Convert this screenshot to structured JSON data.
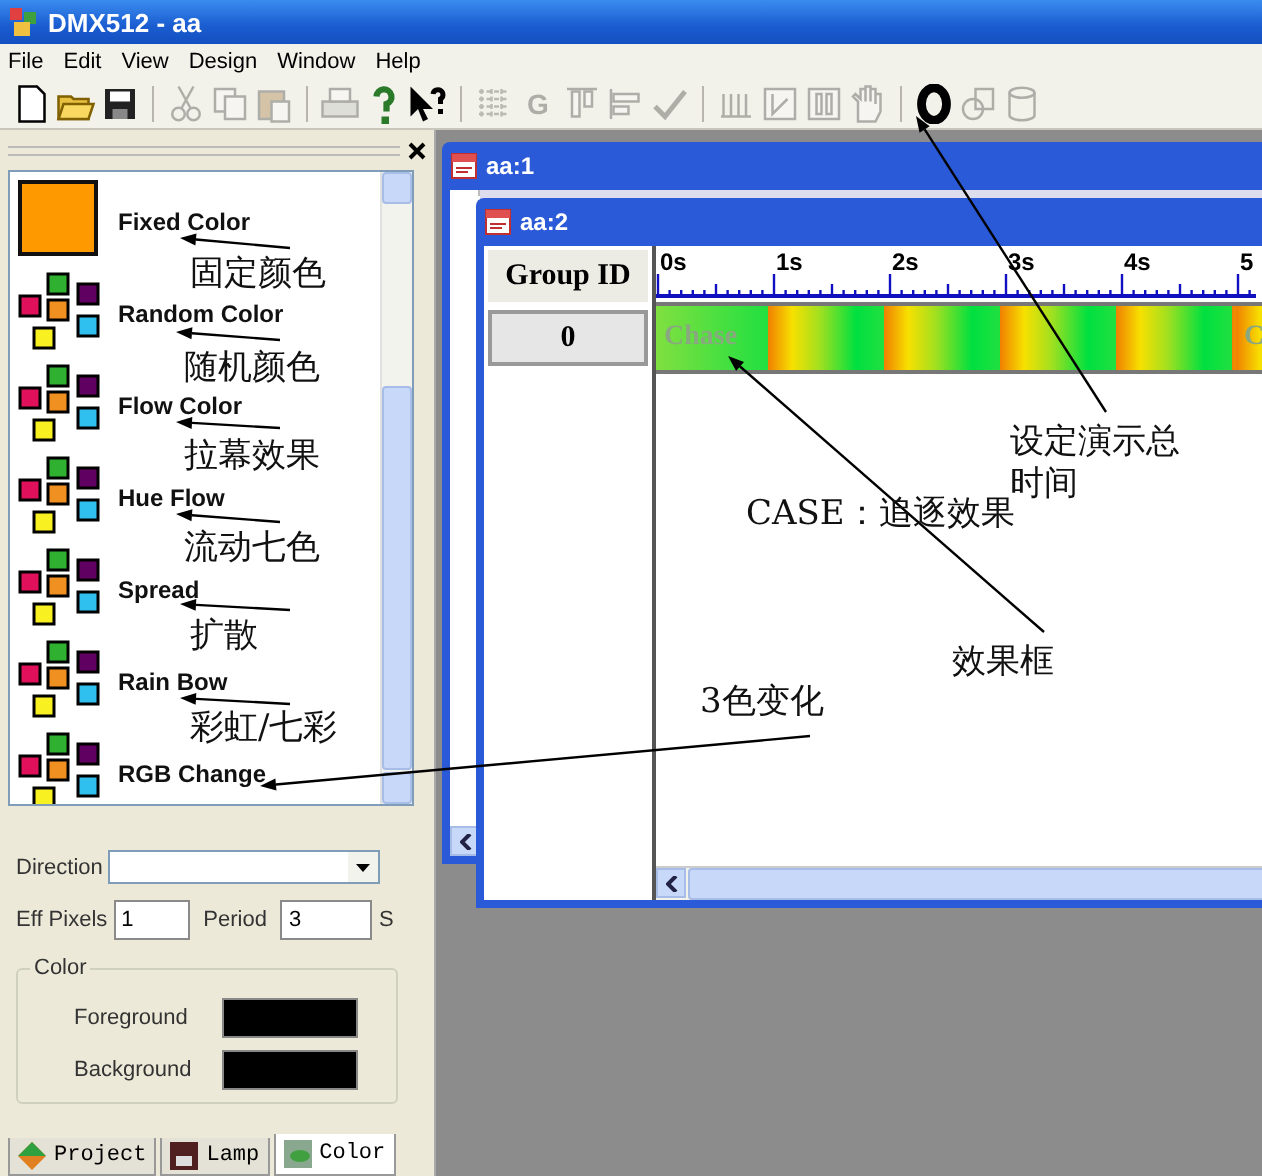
{
  "window": {
    "title": "DMX512 - aa"
  },
  "menu": [
    "File",
    "Edit",
    "View",
    "Design",
    "Window",
    "Help"
  ],
  "toolbar": [
    {
      "kind": "new",
      "disabled": false
    },
    {
      "kind": "open",
      "disabled": false
    },
    {
      "kind": "save",
      "disabled": false
    },
    {
      "kind": "separator"
    },
    {
      "kind": "cut",
      "disabled": true
    },
    {
      "kind": "copy",
      "disabled": true
    },
    {
      "kind": "paste",
      "disabled": true
    },
    {
      "kind": "separator"
    },
    {
      "kind": "print",
      "disabled": true
    },
    {
      "kind": "help",
      "disabled": false
    },
    {
      "kind": "context-help",
      "disabled": false
    },
    {
      "kind": "separator"
    },
    {
      "kind": "grid",
      "disabled": true
    },
    {
      "kind": "letter",
      "label": "G",
      "disabled": true
    },
    {
      "kind": "align-top",
      "disabled": true
    },
    {
      "kind": "align-left",
      "disabled": true
    },
    {
      "kind": "check",
      "disabled": true
    },
    {
      "kind": "separator"
    },
    {
      "kind": "comb",
      "disabled": true
    },
    {
      "kind": "frame",
      "disabled": true
    },
    {
      "kind": "columns",
      "disabled": true
    },
    {
      "kind": "hand",
      "disabled": true
    },
    {
      "kind": "separator"
    },
    {
      "kind": "timer",
      "disabled": false
    },
    {
      "kind": "link",
      "disabled": true
    },
    {
      "kind": "cylinder",
      "disabled": true
    }
  ],
  "effects": [
    {
      "label": "Fixed Color",
      "kind": "solid"
    },
    {
      "label": "Random Color",
      "kind": "cluster"
    },
    {
      "label": "Flow Color",
      "kind": "cluster"
    },
    {
      "label": "Hue Flow",
      "kind": "cluster"
    },
    {
      "label": "Spread",
      "kind": "cluster"
    },
    {
      "label": "Rain Bow",
      "kind": "cluster"
    },
    {
      "label": "RGB Change",
      "kind": "cluster"
    }
  ],
  "properties": {
    "direction": {
      "label": "Direction"
    },
    "eff_pixels": {
      "label": "Eff Pixels",
      "value": "1"
    },
    "period": {
      "label": "Period",
      "value": "3",
      "unit": "S"
    },
    "color_group": {
      "title": "Color",
      "rows": [
        {
          "label": "Foreground",
          "color": "#000000"
        },
        {
          "label": "Background",
          "color": "#000000"
        }
      ]
    }
  },
  "panel_tabs": [
    {
      "label": "Project",
      "selected": false
    },
    {
      "label": "Lamp",
      "selected": false
    },
    {
      "label": "Color",
      "selected": true
    }
  ],
  "back_window": {
    "title": "aa:1"
  },
  "front_window": {
    "title": "aa:2",
    "group_header": "Group ID",
    "groups": [
      "0"
    ],
    "ruler": [
      "0s",
      "1s",
      "2s",
      "3s",
      "4s",
      "5"
    ],
    "effects": [
      {
        "label": "Chase"
      },
      {
        "label": "C"
      }
    ]
  },
  "annotations": [
    {
      "text": "固定颜色"
    },
    {
      "text": "随机颜色"
    },
    {
      "text": "拉幕效果"
    },
    {
      "text": "流动七色"
    },
    {
      "text": "扩散"
    },
    {
      "text": "彩虹/七彩"
    },
    {
      "text": "3色变化"
    },
    {
      "text": "设定演示总时间"
    },
    {
      "text": "CASE：追逐效果"
    },
    {
      "text": "效果框"
    }
  ]
}
